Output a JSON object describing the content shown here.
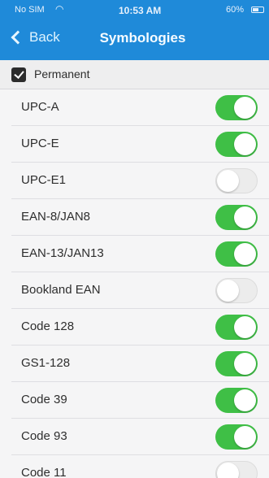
{
  "status": {
    "carrier": "No SIM",
    "time": "10:53 AM",
    "battery": "60%",
    "battery_level": 0.6
  },
  "nav": {
    "back_label": "Back",
    "title": "Symbologies"
  },
  "permanent": {
    "label": "Permanent",
    "checked": true
  },
  "symbologies": [
    {
      "label": "UPC-A",
      "enabled": true
    },
    {
      "label": "UPC-E",
      "enabled": true
    },
    {
      "label": "UPC-E1",
      "enabled": false
    },
    {
      "label": "EAN-8/JAN8",
      "enabled": true
    },
    {
      "label": "EAN-13/JAN13",
      "enabled": true
    },
    {
      "label": "Bookland EAN",
      "enabled": false
    },
    {
      "label": "Code 128",
      "enabled": true
    },
    {
      "label": "GS1-128",
      "enabled": true
    },
    {
      "label": "Code 39",
      "enabled": true
    },
    {
      "label": "Code 93",
      "enabled": true
    },
    {
      "label": "Code 11",
      "enabled": false
    }
  ],
  "colors": {
    "nav_bar": "#1f8ad9",
    "toggle_on": "#3fbf46",
    "toggle_off": "#ececec"
  }
}
